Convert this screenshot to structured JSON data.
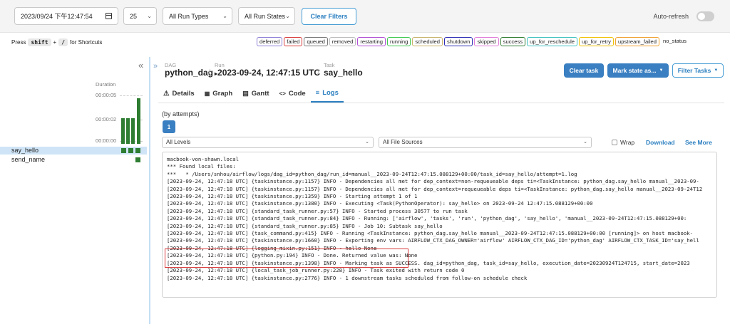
{
  "filters": {
    "datetime": "2023/09/24 下午12:47:54",
    "num_runs": "25",
    "run_types": "All Run Types",
    "run_states": "All Run States",
    "clear_filters": "Clear Filters",
    "auto_refresh": "Auto-refresh"
  },
  "shortcuts": {
    "press": "Press",
    "key1": "shift",
    "plus": "+",
    "key2": "/",
    "suffix": "for Shortcuts"
  },
  "states": [
    {
      "label": "deferred",
      "color": "#8b7fd6"
    },
    {
      "label": "failed",
      "color": "#d93b3b"
    },
    {
      "label": "queued",
      "color": "#777777"
    },
    {
      "label": "removed",
      "color": "#bbbbbb"
    },
    {
      "label": "restarting",
      "color": "#b04fd6"
    },
    {
      "label": "running",
      "color": "#3fc94f"
    },
    {
      "label": "scheduled",
      "color": "#c8b26b"
    },
    {
      "label": "shutdown",
      "color": "#2b2bb5"
    },
    {
      "label": "skipped",
      "color": "#e07ad9"
    },
    {
      "label": "success",
      "color": "#2e7d32"
    },
    {
      "label": "up_for_reschedule",
      "color": "#40c0c0"
    },
    {
      "label": "up_for_retry",
      "color": "#f0c000"
    },
    {
      "label": "upstream_failed",
      "color": "#f0a030"
    },
    {
      "label": "no_status",
      "color": ""
    }
  ],
  "grid": {
    "duration_label": "Duration",
    "ticks": [
      "00:00:05",
      "00:00:02",
      "00:00:00"
    ],
    "tasks": [
      "say_hello",
      "send_name"
    ]
  },
  "breadcrumb": {
    "dag_label": "DAG",
    "dag": "python_dag",
    "run_label": "Run",
    "run": "2023-09-24, 12:47:15 UTC",
    "task_label": "Task",
    "task": "say_hello"
  },
  "actions": {
    "clear_task": "Clear task",
    "mark_state": "Mark state as...",
    "filter_tasks": "Filter Tasks"
  },
  "tabs": [
    {
      "label": "Details",
      "icon": "warning-icon"
    },
    {
      "label": "Graph",
      "icon": "graph-icon"
    },
    {
      "label": "Gantt",
      "icon": "gantt-icon"
    },
    {
      "label": "Code",
      "icon": "code-icon"
    },
    {
      "label": "Logs",
      "icon": "list-icon"
    }
  ],
  "logs": {
    "attempts_label": "(by attempts)",
    "attempt": "1",
    "levels": "All Levels",
    "sources": "All File Sources",
    "wrap": "Wrap",
    "download": "Download",
    "see_more": "See More",
    "lines": [
      "macbook-von-shawn.local",
      "*** Found local files:",
      "***   * /Users/snhou/airflow/logs/dag_id=python_dag/run_id=manual__2023-09-24T12:47:15.088129+00:00/task_id=say_hello/attempt=1.log",
      "[2023-09-24, 12:47:18 UTC] {taskinstance.py:1157} INFO - Dependencies all met for dep_context=non-requeueable deps ti=<TaskInstance: python_dag.say_hello manual__2023-09-",
      "[2023-09-24, 12:47:18 UTC] {taskinstance.py:1157} INFO - Dependencies all met for dep_context=requeueable deps ti=<TaskInstance: python_dag.say_hello manual__2023-09-24T12",
      "[2023-09-24, 12:47:18 UTC] {taskinstance.py:1359} INFO - Starting attempt 1 of 1",
      "[2023-09-24, 12:47:18 UTC] {taskinstance.py:1380} INFO - Executing <Task(PythonOperator): say_hello> on 2023-09-24 12:47:15.088129+00:00",
      "[2023-09-24, 12:47:18 UTC] {standard_task_runner.py:57} INFO - Started process 30577 to run task",
      "[2023-09-24, 12:47:18 UTC] {standard_task_runner.py:84} INFO - Running: ['airflow', 'tasks', 'run', 'python_dag', 'say_hello', 'manual__2023-09-24T12:47:15.088129+00:",
      "[2023-09-24, 12:47:18 UTC] {standard_task_runner.py:85} INFO - Job 10: Subtask say_hello",
      "[2023-09-24, 12:47:18 UTC] {task_command.py:415} INFO - Running <TaskInstance: python_dag.say_hello manual__2023-09-24T12:47:15.088129+00:00 [running]> on host macbook-",
      "[2023-09-24, 12:47:18 UTC] {taskinstance.py:1660} INFO - Exporting env vars: AIRFLOW_CTX_DAG_OWNER='airflow' AIRFLOW_CTX_DAG_ID='python_dag' AIRFLOW_CTX_TASK_ID='say_hell",
      "[2023-09-24, 12:47:18 UTC] {logging_mixin.py:151} INFO - hello None",
      "[2023-09-24, 12:47:18 UTC] {python.py:194} INFO - Done. Returned value was: None",
      "[2023-09-24, 12:47:18 UTC] {taskinstance.py:1398} INFO - Marking task as SUCCESS. dag_id=python_dag, task_id=say_hello, execution_date=20230924T124715, start_date=2023",
      "[2023-09-24, 12:47:18 UTC] {local_task_job_runner.py:228} INFO - Task exited with return code 0",
      "[2023-09-24, 12:47:18 UTC] {taskinstance.py:2776} INFO - 1 downstream tasks scheduled from follow-on schedule check"
    ]
  }
}
